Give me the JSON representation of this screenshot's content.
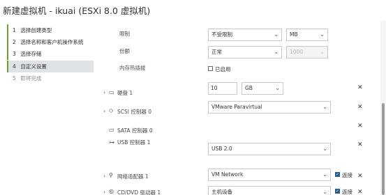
{
  "window": {
    "title": "新建虚拟机 - ikuai (ESXi 8.0 虚拟机)"
  },
  "steps": [
    {
      "num": "1",
      "label": "选择创建类型"
    },
    {
      "num": "2",
      "label": "选择名称和客户机操作系统"
    },
    {
      "num": "3",
      "label": "选择存储"
    },
    {
      "num": "4",
      "label": "自定义设置"
    },
    {
      "num": "5",
      "label": "即将完成"
    }
  ],
  "memory": {
    "limit_label": "限制",
    "limit_value": "不受限制",
    "limit_unit": "MB",
    "shares_label": "份额",
    "shares_value": "正常",
    "shares_number": "1000",
    "hotplug_label": "内存热插拔",
    "hotplug_checkbox_label": "已启用"
  },
  "devices": {
    "disk": {
      "label": "硬盘 1",
      "size": "10",
      "unit": "GB"
    },
    "scsi": {
      "label": "SCSI 控制器 0",
      "value": "VMware Paravirtual"
    },
    "sata": {
      "label": "SATA 控制器 0"
    },
    "usb": {
      "label": "USB 控制器 1",
      "value": "USB 2.0"
    },
    "network": {
      "label": "网络适配器 1",
      "value": "VM Network",
      "connect_label": "连接"
    },
    "cddvd": {
      "label": "CD/DVD 驱动器 1",
      "value": "主机设备",
      "connect_label": "连接"
    }
  },
  "icons": {
    "expander": "chevron-right-icon",
    "close": "close-icon",
    "disk": "hard-disk-icon",
    "scsi": "scsi-controller-icon",
    "sata": "sata-controller-icon",
    "usb": "usb-icon",
    "network": "network-adapter-icon",
    "cddvd": "cd-dvd-icon"
  },
  "colors": {
    "completed_step_accent": "#6a9e3c",
    "active_step_background": "#e0e3e6",
    "checkbox_checked": "#2a5b86"
  }
}
